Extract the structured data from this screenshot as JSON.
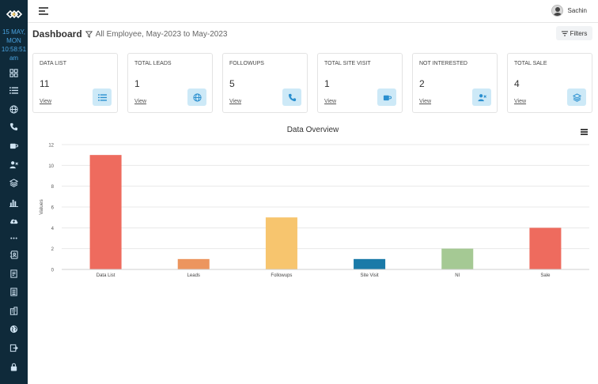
{
  "sidebar": {
    "datetime": {
      "date": "15 MAY,",
      "day": "MON",
      "time": "10:58:51",
      "ampm": "am"
    },
    "items": [
      {
        "icon": "grid-icon"
      },
      {
        "icon": "list-icon"
      },
      {
        "icon": "globe-icon"
      },
      {
        "icon": "phone-icon"
      },
      {
        "icon": "coffee-icon"
      },
      {
        "icon": "user-x-icon"
      },
      {
        "icon": "layers-icon"
      },
      {
        "icon": "bar-chart-icon"
      },
      {
        "icon": "cloud-upload-icon"
      },
      {
        "icon": "more-icon"
      },
      {
        "icon": "contacts-icon"
      },
      {
        "icon": "document-icon"
      },
      {
        "icon": "report-icon"
      },
      {
        "icon": "building-icon"
      },
      {
        "icon": "globe-alt-icon"
      },
      {
        "icon": "export-icon"
      },
      {
        "icon": "lock-icon"
      }
    ]
  },
  "header": {
    "user_name": "Sachin"
  },
  "page": {
    "title": "Dashboard",
    "subtitle": "All Employee, May-2023 to May-2023",
    "filters_label": "Filters"
  },
  "cards": [
    {
      "label": "DATA LIST",
      "value": "11",
      "link": "View",
      "icon": "list-icon"
    },
    {
      "label": "TOTAL LEADS",
      "value": "1",
      "link": "View",
      "icon": "globe-icon"
    },
    {
      "label": "FOLLOWUPS",
      "value": "5",
      "link": "View",
      "icon": "phone-icon"
    },
    {
      "label": "TOTAL SITE VISIT",
      "value": "1",
      "link": "View",
      "icon": "coffee-icon"
    },
    {
      "label": "NOT INTERESTED",
      "value": "2",
      "link": "View",
      "icon": "user-x-icon"
    },
    {
      "label": "TOTAL SALE",
      "value": "4",
      "link": "View",
      "icon": "layers-icon"
    }
  ],
  "colors": {
    "sidebar": "#0f2a3a",
    "accent": "#2a8fcf"
  },
  "chart_data": {
    "type": "bar",
    "title": "Data Overview",
    "ylabel": "Values",
    "xlabel": "",
    "ylim": [
      0,
      12
    ],
    "yticks": [
      0,
      2,
      4,
      6,
      8,
      10,
      12
    ],
    "grid": true,
    "categories": [
      "Data List",
      "Leads",
      "Followups",
      "Site Visit",
      "NI",
      "Sale"
    ],
    "values": [
      11,
      1,
      5,
      1,
      2,
      4
    ],
    "colors": [
      "#ee6b5e",
      "#ec955e",
      "#f7c56e",
      "#1a7aa8",
      "#a5c994",
      "#ee6b5e"
    ]
  }
}
